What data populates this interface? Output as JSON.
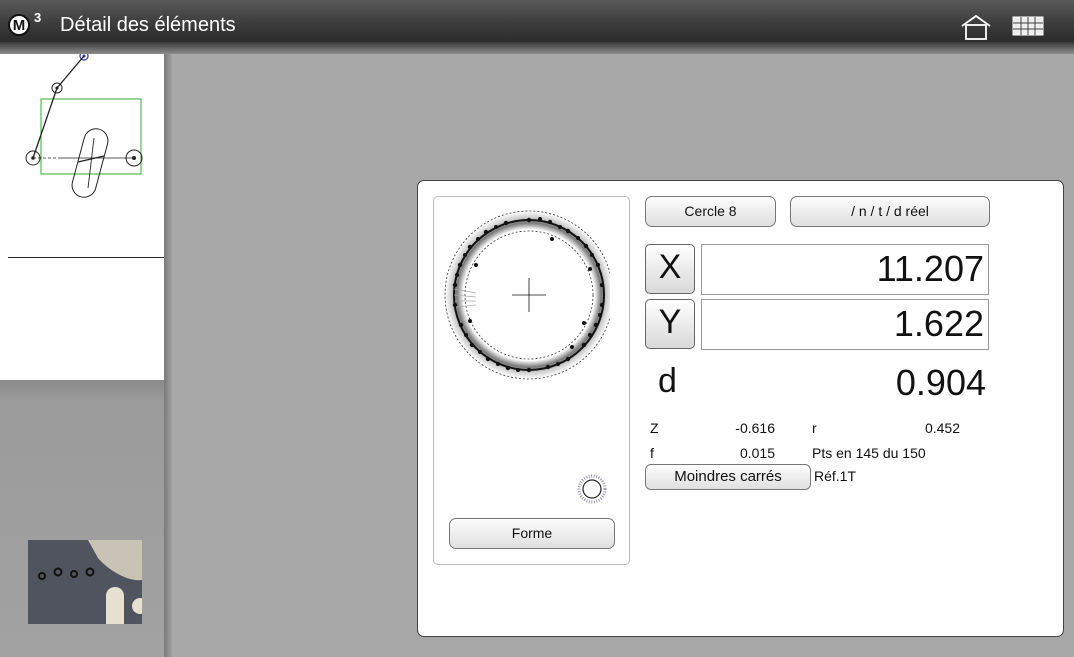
{
  "header": {
    "logo_letter": "M",
    "logo_sup": "3",
    "title": "Détail des éléments"
  },
  "feature": {
    "name_button": "Cercle 8",
    "mode_button": "/ n / t / d réel",
    "x_label": "X",
    "x_value": "11.207",
    "y_label": "Y",
    "y_value": "1.622",
    "d_label": "d",
    "d_value": "0.904",
    "z_label": "Z",
    "z_value": "-0.616",
    "r_label": "r",
    "r_value": "0.452",
    "f_label": "f",
    "f_value": "0.015",
    "points_text": "Pts en 145 du 150",
    "fit_button": "Moindres carrés",
    "ref_text": "Réf.1T",
    "form_button": "Forme"
  },
  "icons": {
    "home": "home-icon",
    "grid": "grid-view-icon",
    "logo": "m3-logo-icon"
  }
}
